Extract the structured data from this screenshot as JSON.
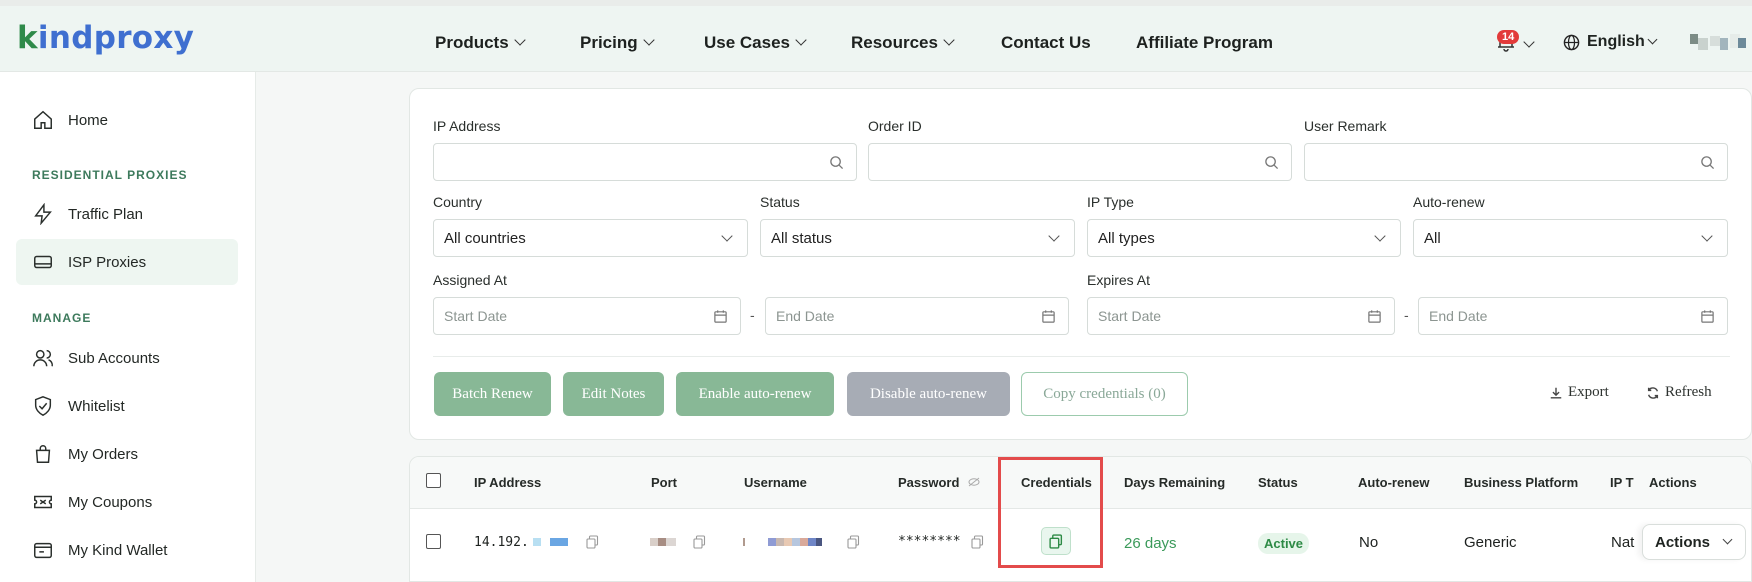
{
  "brand": {
    "logo_k": "k",
    "logo_rest": "indproxy"
  },
  "nav": {
    "items": [
      {
        "label": "Products",
        "dropdown": true
      },
      {
        "label": "Pricing",
        "dropdown": true
      },
      {
        "label": "Use Cases",
        "dropdown": true
      },
      {
        "label": "Resources",
        "dropdown": true
      },
      {
        "label": "Contact Us",
        "dropdown": false
      },
      {
        "label": "Affiliate Program",
        "dropdown": false
      }
    ],
    "notification_count": "14",
    "language": "English"
  },
  "sidebar": {
    "home": "Home",
    "section_residential": "RESIDENTIAL PROXIES",
    "traffic_plan": "Traffic Plan",
    "isp_proxies": "ISP Proxies",
    "section_manage": "MANAGE",
    "sub_accounts": "Sub Accounts",
    "whitelist": "Whitelist",
    "my_orders": "My Orders",
    "my_coupons": "My Coupons",
    "my_kind_wallet": "My Kind Wallet"
  },
  "filters": {
    "ip_address_label": "IP Address",
    "ip_address_value": "",
    "order_id_label": "Order ID",
    "order_id_value": "",
    "user_remark_label": "User Remark",
    "user_remark_value": "",
    "country_label": "Country",
    "country_value": "All countries",
    "status_label": "Status",
    "status_value": "All status",
    "ip_type_label": "IP Type",
    "ip_type_value": "All types",
    "auto_renew_label": "Auto-renew",
    "auto_renew_value": "All",
    "assigned_at_label": "Assigned At",
    "expires_at_label": "Expires At",
    "start_date_placeholder": "Start Date",
    "end_date_placeholder": "End Date",
    "range_separator": "-"
  },
  "actions": {
    "batch_renew": "Batch Renew",
    "edit_notes": "Edit Notes",
    "enable_auto_renew": "Enable auto-renew",
    "disable_auto_renew": "Disable auto-renew",
    "copy_credentials": "Copy credentials (0)",
    "export": "Export",
    "refresh": "Refresh"
  },
  "table": {
    "columns": [
      "IP Address",
      "Port",
      "Username",
      "Password",
      "Credentials",
      "Days Remaining",
      "Status",
      "Auto-renew",
      "Business Platform",
      "IP T",
      "Actions"
    ],
    "rows": [
      {
        "ip_prefix": "14.192.",
        "password": "********",
        "days_remaining": "26 days",
        "status": "Active",
        "auto_renew": "No",
        "business_platform": "Generic",
        "ip_type": "Nat",
        "actions_label": "Actions"
      }
    ]
  },
  "colors": {
    "brand_blue": "#3f6fd0",
    "brand_green": "#2f8a4a",
    "primary_button": "#88b896",
    "disabled_button": "#a7acb5",
    "highlight": "#e34b4b"
  }
}
